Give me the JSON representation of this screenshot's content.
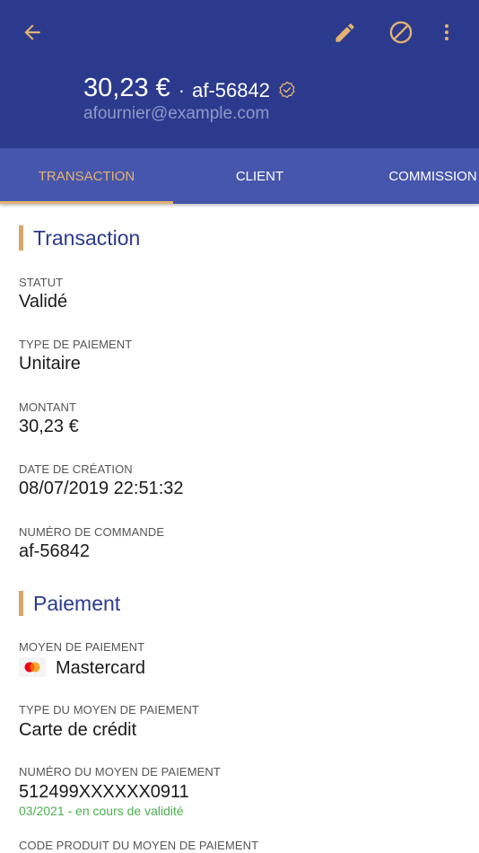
{
  "header": {
    "amount": "30,23 €",
    "separator": "·",
    "order_id": "af-56842",
    "email": "afournier@example.com",
    "icons": {
      "back": "arrow-back-icon",
      "edit": "pencil-icon",
      "cancel": "block-icon",
      "more": "more-vert-icon",
      "verified": "verified-badge-icon"
    },
    "colors": {
      "background": "#2b3a8c",
      "accent": "#e4b271"
    }
  },
  "tabs": [
    {
      "label": "TRANSACTION",
      "active": true
    },
    {
      "label": "CLIENT",
      "active": false
    },
    {
      "label": "COMMISSION",
      "active": false
    }
  ],
  "sections": {
    "transaction": {
      "title": "Transaction",
      "fields": {
        "status": {
          "label": "STATUT",
          "value": "Validé"
        },
        "payment_type": {
          "label": "TYPE DE PAIEMENT",
          "value": "Unitaire"
        },
        "amount": {
          "label": "MONTANT",
          "value": "30,23 €"
        },
        "created_at": {
          "label": "DATE DE CRÉATION",
          "value": "08/07/2019 22:51:32"
        },
        "order_number": {
          "label": "NUMÉRO DE COMMANDE",
          "value": "af-56842"
        }
      }
    },
    "payment": {
      "title": "Paiement",
      "fields": {
        "method": {
          "label": "MOYEN DE PAIEMENT",
          "value": "Mastercard",
          "icon": "mastercard-logo-icon"
        },
        "method_type": {
          "label": "TYPE DU MOYEN DE PAIEMENT",
          "value": "Carte de crédit"
        },
        "method_number": {
          "label": "NUMÉRO DU MOYEN DE PAIEMENT",
          "value": "512499XXXXXX0911",
          "validity": "03/2021 - en cours de validité"
        },
        "product_code": {
          "label": "CODE PRODUIT DU MOYEN DE PAIEMENT"
        }
      }
    }
  },
  "colors": {
    "section_accent": "#d4a86a",
    "section_title": "#2b3a8c",
    "valid": "#4caf50"
  }
}
